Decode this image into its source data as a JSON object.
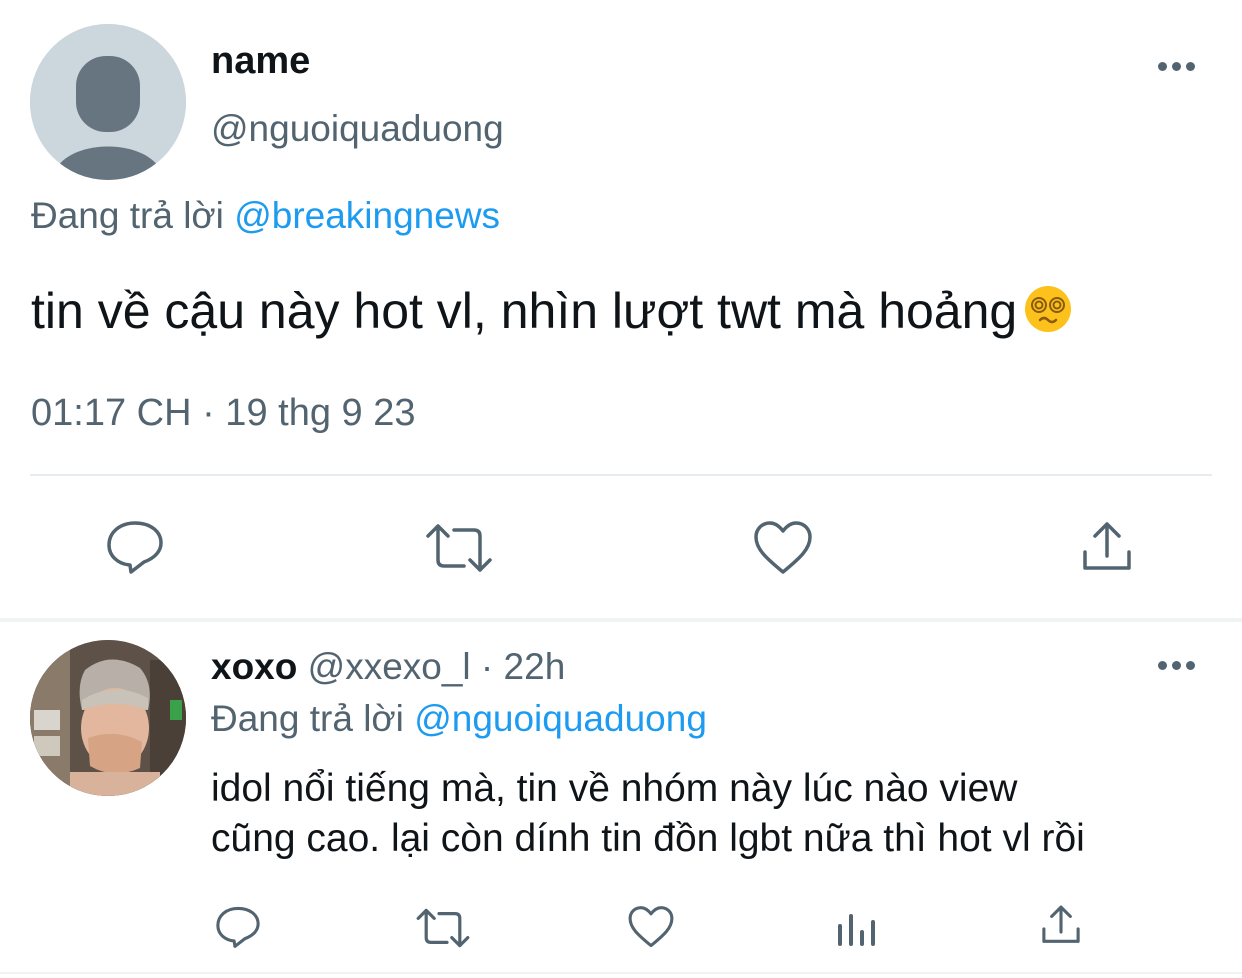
{
  "main_tweet": {
    "name": "name",
    "handle": "@nguoiquaduong",
    "reply_prefix": "Đang trả lời",
    "reply_mention": "@breakingnews",
    "text": "tin về cậu này hot vl, nhìn lượt twt mà hoảng",
    "emoji": "dizzy-face-emoji",
    "timestamp": "01:17 CH · 19 thg 9 23",
    "actions": [
      "reply-icon",
      "retweet-icon",
      "like-icon",
      "share-icon"
    ]
  },
  "reply_tweet": {
    "name": "xoxo",
    "handle": "@xxexo_l",
    "separator": " · ",
    "time": "22h",
    "reply_prefix": "Đang trả lời",
    "reply_mention": "@nguoiquaduong",
    "text_line1": "idol nổi tiếng mà, tin về nhóm này lúc nào view",
    "text_line2": "cũng cao. lại còn dính tin đồn lgbt nữa thì hot vl rồi",
    "actions": [
      "reply-icon",
      "retweet-icon",
      "like-icon",
      "analytics-icon",
      "share-icon"
    ]
  },
  "colors": {
    "text": "#0f1419",
    "muted": "#536471",
    "link": "#1d9bf0",
    "divider": "#e6ecf0"
  }
}
